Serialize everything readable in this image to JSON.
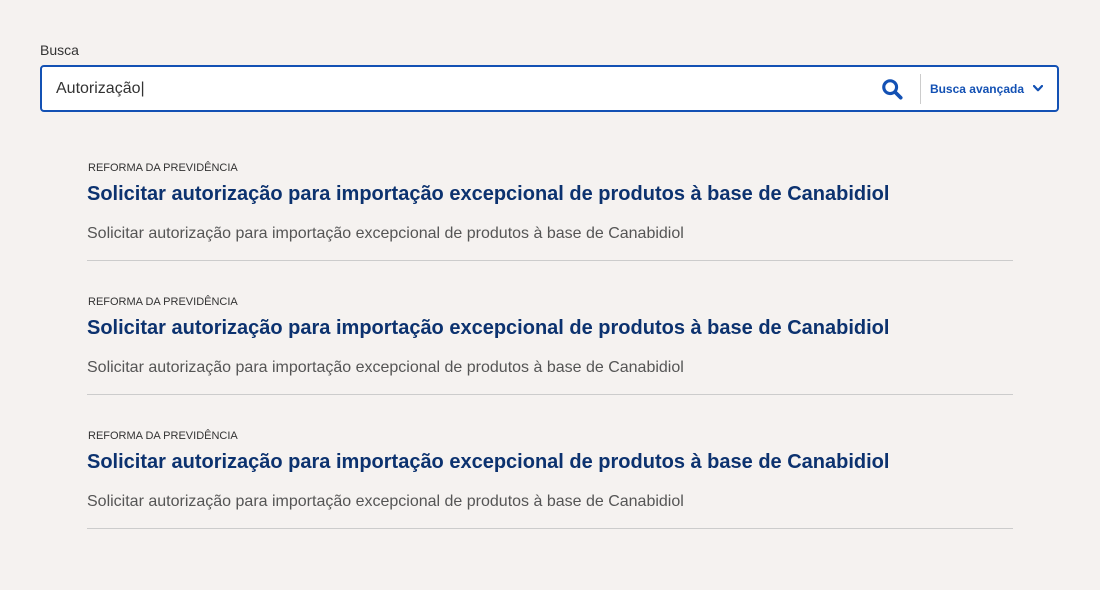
{
  "search": {
    "label": "Busca",
    "value": "Autorização|",
    "advanced_label": "Busca avançada",
    "accent_color": "#1351b4"
  },
  "icons": {
    "search": "search-icon",
    "advanced": "chevron-down-icon"
  },
  "results": [
    {
      "category": "REFORMA DA PREVIDÊNCIA",
      "title": "Solicitar autorização para importação excepcional de produtos à base de Canabidiol",
      "description": "Solicitar autorização para importação excepcional de produtos à base de Canabidiol"
    },
    {
      "category": "REFORMA DA PREVIDÊNCIA",
      "title": "Solicitar autorização para importação excepcional de produtos à base de Canabidiol",
      "description": "Solicitar autorização para importação excepcional de produtos à base de Canabidiol"
    },
    {
      "category": "REFORMA DA PREVIDÊNCIA",
      "title": "Solicitar autorização para importação excepcional de produtos à base de Canabidiol",
      "description": "Solicitar autorização para importação excepcional de produtos à base de Canabidiol"
    }
  ],
  "colors": {
    "background": "#f5f2f0",
    "title": "#0c326f",
    "text": "#555555",
    "divider": "#cccccc"
  }
}
